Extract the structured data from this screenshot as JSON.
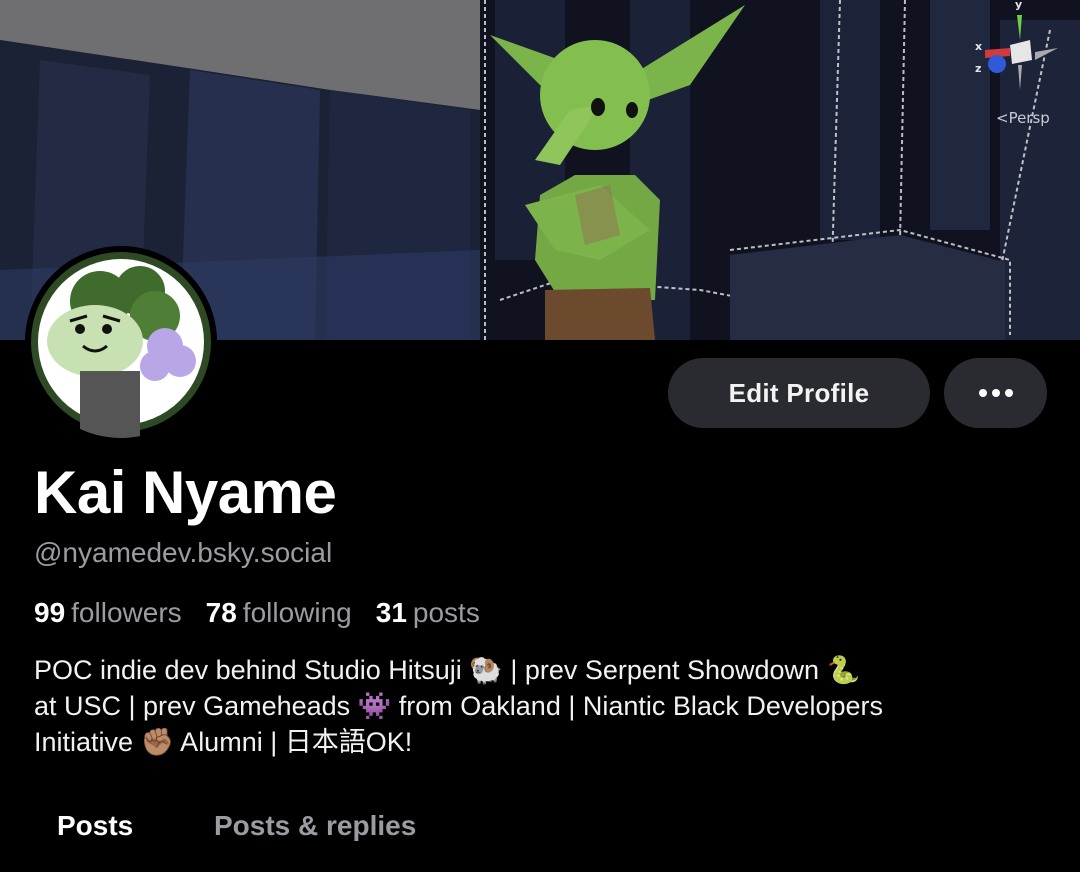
{
  "banner": {
    "gizmo_label": "<Persp",
    "axis_y": "y",
    "axis_x": "x",
    "axis_z": "z"
  },
  "actions": {
    "edit_profile": "Edit Profile",
    "more_icon": "ellipsis-icon"
  },
  "profile": {
    "name": "Kai Nyame",
    "handle": "@nyamedev.bsky.social",
    "stats": [
      {
        "value": "99",
        "label": "followers"
      },
      {
        "value": "78",
        "label": "following"
      },
      {
        "value": "31",
        "label": "posts"
      }
    ],
    "bio_lines": [
      "POC indie dev behind Studio Hitsuji 🐏 | prev Serpent Showdown 🐍",
      "at USC | prev Gameheads 👾 from Oakland | Niantic Black Developers",
      "Initiative ✊🏽 Alumni | 日本語OK!"
    ]
  },
  "tabs": [
    {
      "label": "Posts",
      "active": true
    },
    {
      "label": "Posts & replies",
      "active": false
    }
  ]
}
